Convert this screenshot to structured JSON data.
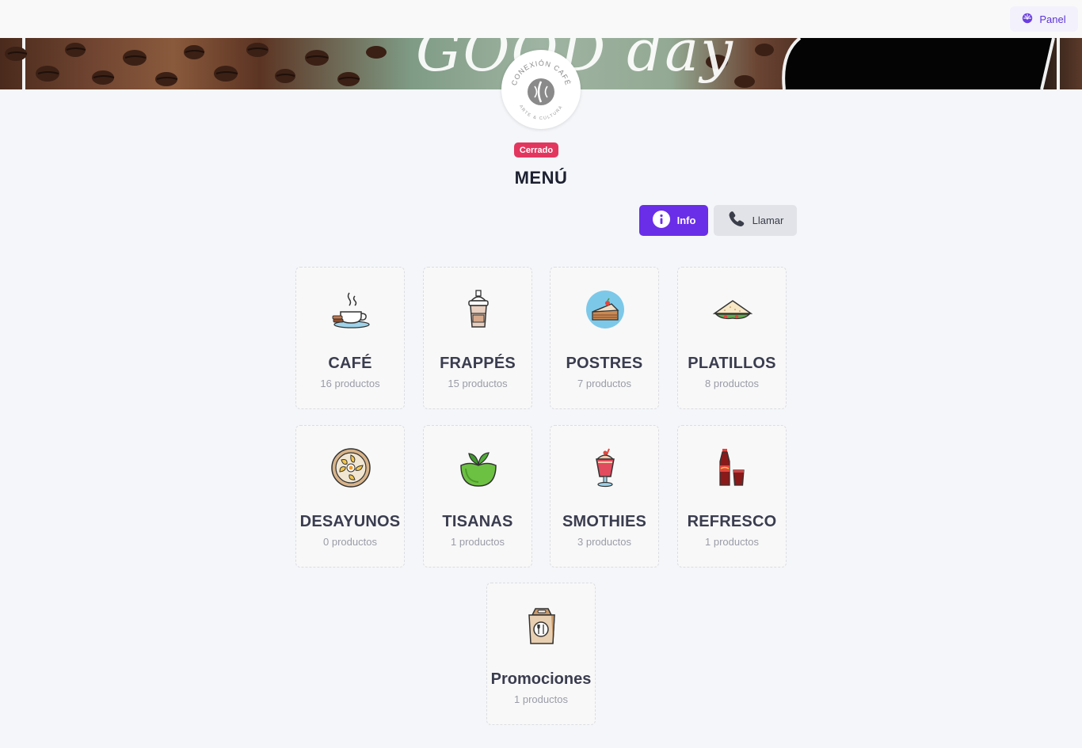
{
  "header": {
    "panel_label": "Panel",
    "panel_icon": "dashboard-icon"
  },
  "banner": {
    "text": "GOOD day"
  },
  "logo": {
    "top_text": "CONEXIÓN CAFÉ",
    "bottom_text": "ARTE & CULTURA"
  },
  "status": {
    "label": "Cerrado",
    "color": "#e3365f"
  },
  "page": {
    "title": "MENÚ"
  },
  "actions": {
    "info_label": "Info",
    "call_label": "Llamar",
    "accent": "#6a2ee8"
  },
  "categories": [
    {
      "name": "CAFÉ",
      "count": "16 productos",
      "icon": "coffee-cup-icon"
    },
    {
      "name": "FRAPPÉS",
      "count": "15 productos",
      "icon": "frappe-cup-icon"
    },
    {
      "name": "POSTRES",
      "count": "7 productos",
      "icon": "cake-slice-icon"
    },
    {
      "name": "PLATILLOS",
      "count": "8 productos",
      "icon": "sandwich-icon"
    },
    {
      "name": "DESAYUNOS",
      "count": "0 productos",
      "icon": "breakfast-plate-icon"
    },
    {
      "name": "TISANAS",
      "count": "1 productos",
      "icon": "herbal-tea-icon"
    },
    {
      "name": "SMOTHIES",
      "count": "3 productos",
      "icon": "smoothie-glass-icon"
    },
    {
      "name": "REFRESCO",
      "count": "1 productos",
      "icon": "soda-bottle-icon"
    },
    {
      "name": "Promociones",
      "count": "1 productos",
      "icon": "takeout-bag-icon"
    }
  ]
}
